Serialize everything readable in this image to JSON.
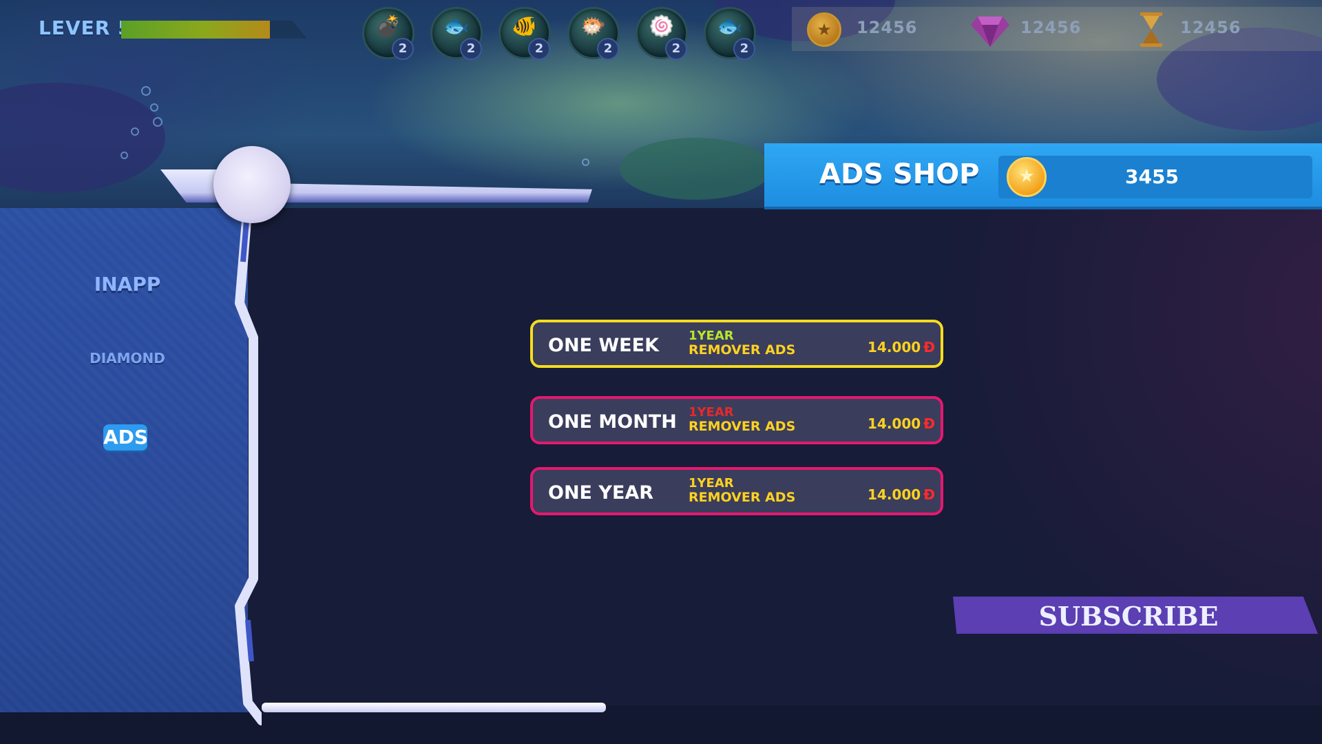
{
  "hud": {
    "level_label": "LEVER 5",
    "xp_progress": 0.8,
    "boosters": [
      {
        "icon": "bomb-icon",
        "glyph": "💣",
        "count": "2"
      },
      {
        "icon": "fish-x2-icon",
        "glyph": "🐟",
        "count": "2"
      },
      {
        "icon": "clownfish-icon",
        "glyph": "🐠",
        "count": "2"
      },
      {
        "icon": "red-fish-icon",
        "glyph": "🐡",
        "count": "2"
      },
      {
        "icon": "swirl-candy-icon",
        "glyph": "🍥",
        "count": "2"
      },
      {
        "icon": "fish-x2-icon",
        "glyph": "🐟",
        "count": "2"
      }
    ],
    "currencies": [
      {
        "icon": "coin-icon",
        "value": "12456"
      },
      {
        "icon": "gem-icon",
        "value": "12456"
      },
      {
        "icon": "hourglass-icon",
        "value": "12456"
      }
    ]
  },
  "tabs": {
    "inapp": "INAPP",
    "diamond": "DIAMOND",
    "ads": "ADS",
    "active": "ads"
  },
  "shop": {
    "title": "ADS SHOP",
    "coin_icon": "coin-icon",
    "balance": "3455"
  },
  "offers": [
    {
      "name": "ONE WEEK",
      "line1": "1YEAR",
      "line2": "REMOVER ADS",
      "price": "14.000",
      "currency": "Đ",
      "border": "#f7dc1e",
      "line1_color": "#b7e82a"
    },
    {
      "name": "ONE MONTH",
      "line1": "1YEAR",
      "line2": "REMOVER ADS",
      "price": "14.000",
      "currency": "Đ",
      "border": "#e5186f",
      "line1_color": "#e52a2a"
    },
    {
      "name": "ONE YEAR",
      "line1": "1YEAR",
      "line2": "REMOVER ADS",
      "price": "14.000",
      "currency": "Đ",
      "border": "#e5186f",
      "line1_color": "#ffd21f"
    }
  ],
  "subscribe_label": "SUBSCRIBE"
}
